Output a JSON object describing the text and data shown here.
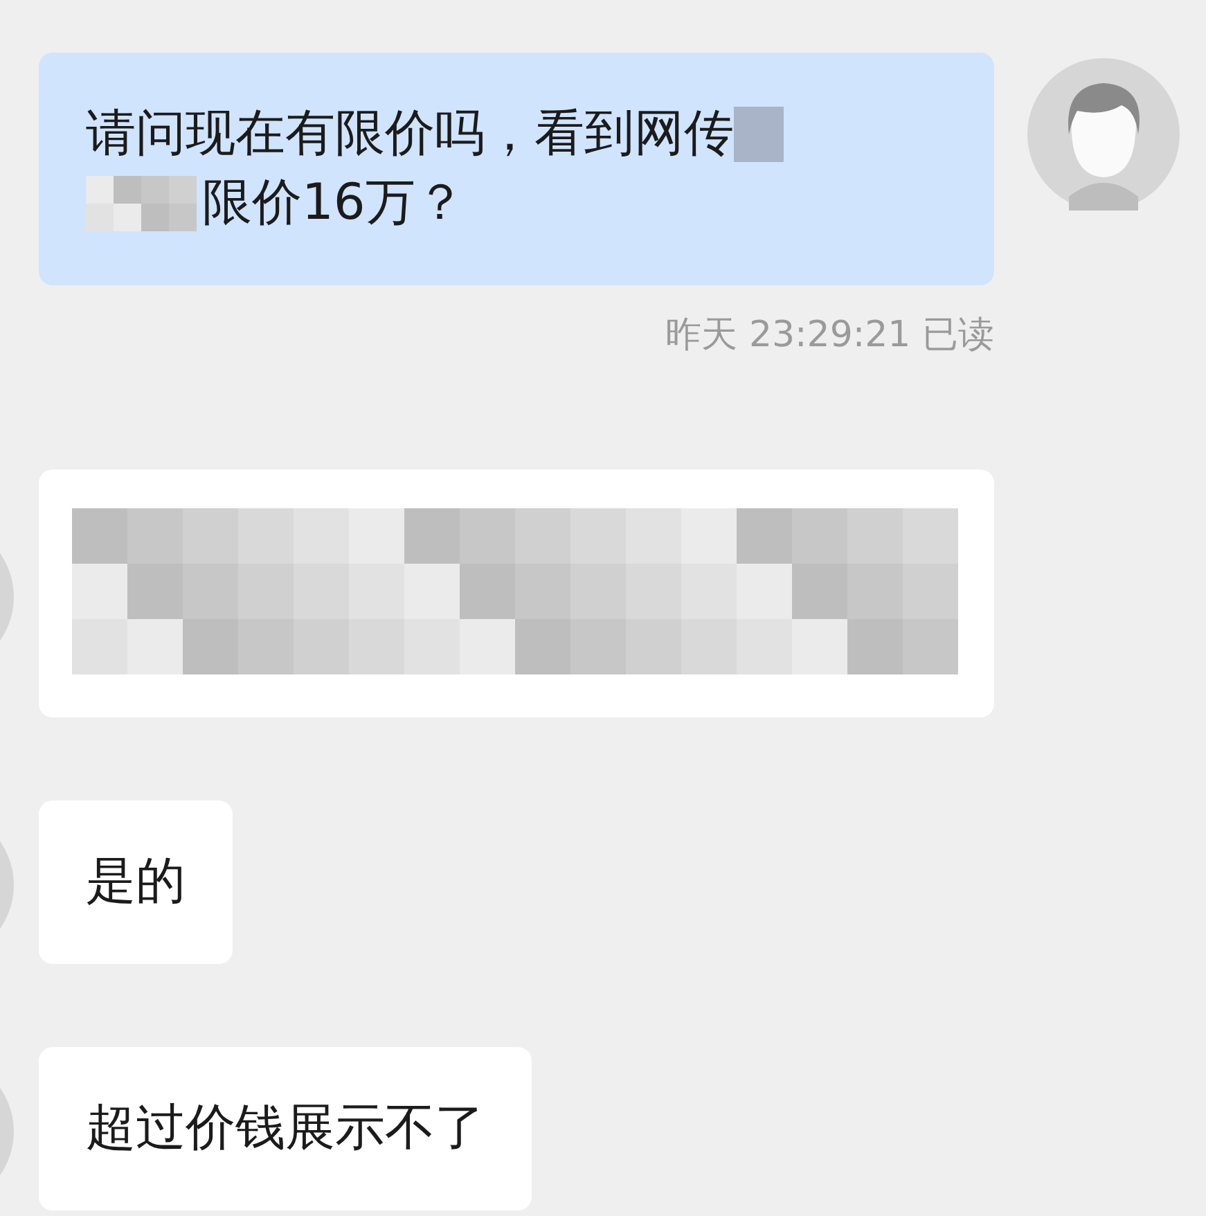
{
  "messages": [
    {
      "outgoing": true,
      "kind": "text",
      "lines": [
        [
          {
            "kind": "text",
            "text": "请问现在有限价吗，看到网传"
          },
          {
            "kind": "redacted"
          }
        ],
        [
          {
            "kind": "redacted"
          },
          {
            "kind": "text",
            "text": "限价16万？"
          }
        ]
      ],
      "meta": "昨天 23:29:21 已读"
    },
    {
      "outgoing": false,
      "kind": "redacted"
    },
    {
      "outgoing": false,
      "kind": "text",
      "lines": [
        [
          {
            "kind": "text",
            "text": "是的"
          }
        ]
      ]
    },
    {
      "outgoing": false,
      "kind": "text",
      "lines": [
        [
          {
            "kind": "text",
            "text": "超过价钱展示不了"
          }
        ]
      ]
    }
  ]
}
